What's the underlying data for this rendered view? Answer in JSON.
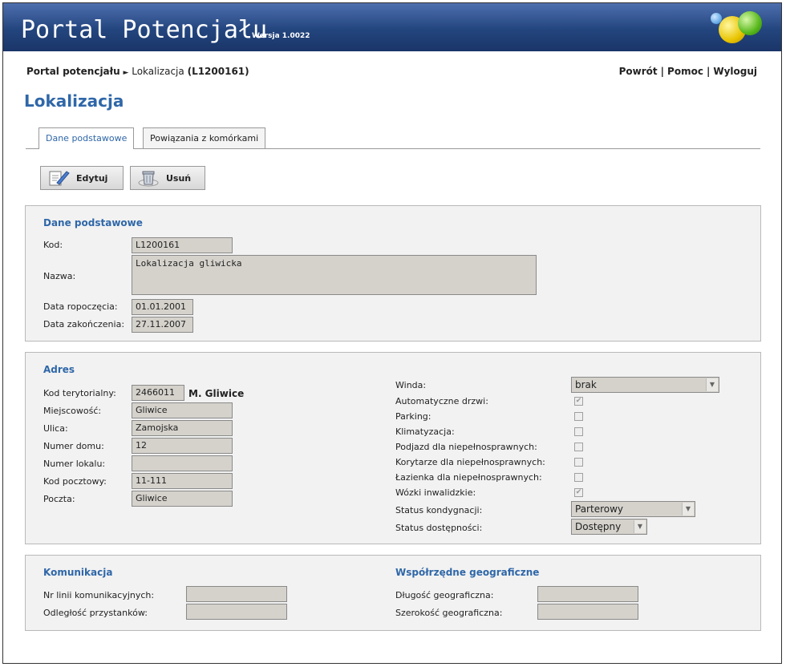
{
  "app": {
    "title": "Portal Potencjału",
    "version": "Wersja 1.0022"
  },
  "breadcrumb": {
    "root": "Portal potencjału",
    "sep": "►",
    "current": "Lokalizacja",
    "code": "(L1200161)"
  },
  "toplinks": {
    "back": "Powrót",
    "help": "Pomoc",
    "logout": "Wyloguj",
    "sep": "|"
  },
  "page_title": "Lokalizacja",
  "tabs": [
    {
      "label": "Dane podstawowe"
    },
    {
      "label": "Powiązania z komórkami"
    }
  ],
  "toolbar": {
    "edit_label": "Edytuj",
    "delete_label": "Usuń"
  },
  "basic": {
    "title": "Dane podstawowe",
    "code_label": "Kod:",
    "code": "L1200161",
    "name_label": "Nazwa:",
    "name": "Lokalizacja gliwicka",
    "start_label": "Data ropoczęcia:",
    "start": "01.01.2001",
    "end_label": "Data zakończenia:",
    "end": "27.11.2007"
  },
  "address": {
    "title": "Adres",
    "terr_label": "Kod terytorialny:",
    "terr": "2466011",
    "terr_name": "M. Gliwice",
    "city_label": "Miejscowość:",
    "city": "Gliwice",
    "street_label": "Ulica:",
    "street": "Zamojska",
    "house_label": "Numer domu:",
    "house": "12",
    "flat_label": "Numer lokalu:",
    "flat": "",
    "zip_label": "Kod pocztowy:",
    "zip": "11-111",
    "post_label": "Poczta:",
    "post": "Gliwice",
    "lift_label": "Winda:",
    "lift": "brak",
    "checks": [
      {
        "label": "Automatyczne drzwi:",
        "checked": true
      },
      {
        "label": "Parking:",
        "checked": false
      },
      {
        "label": "Klimatyzacja:",
        "checked": false
      },
      {
        "label": "Podjazd dla niepełnosprawnych:",
        "checked": false
      },
      {
        "label": "Korytarze dla niepełnosprawnych:",
        "checked": false
      },
      {
        "label": "Łazienka dla niepełnosprawnych:",
        "checked": false
      },
      {
        "label": "Wózki inwalidzkie:",
        "checked": true
      }
    ],
    "floor_status_label": "Status kondygnacji:",
    "floor_status": "Parterowy",
    "access_status_label": "Status dostępności:",
    "access_status": "Dostępny"
  },
  "transport": {
    "title": "Komunikacja",
    "lines_label": "Nr linii komunikacyjnych:",
    "lines": "",
    "stops_label": "Odległość przystanków:",
    "stops": ""
  },
  "geo": {
    "title": "Współrzędne geograficzne",
    "lon_label": "Długość geograficzna:",
    "lon": "",
    "lat_label": "Szerokość geograficzna:",
    "lat": ""
  }
}
